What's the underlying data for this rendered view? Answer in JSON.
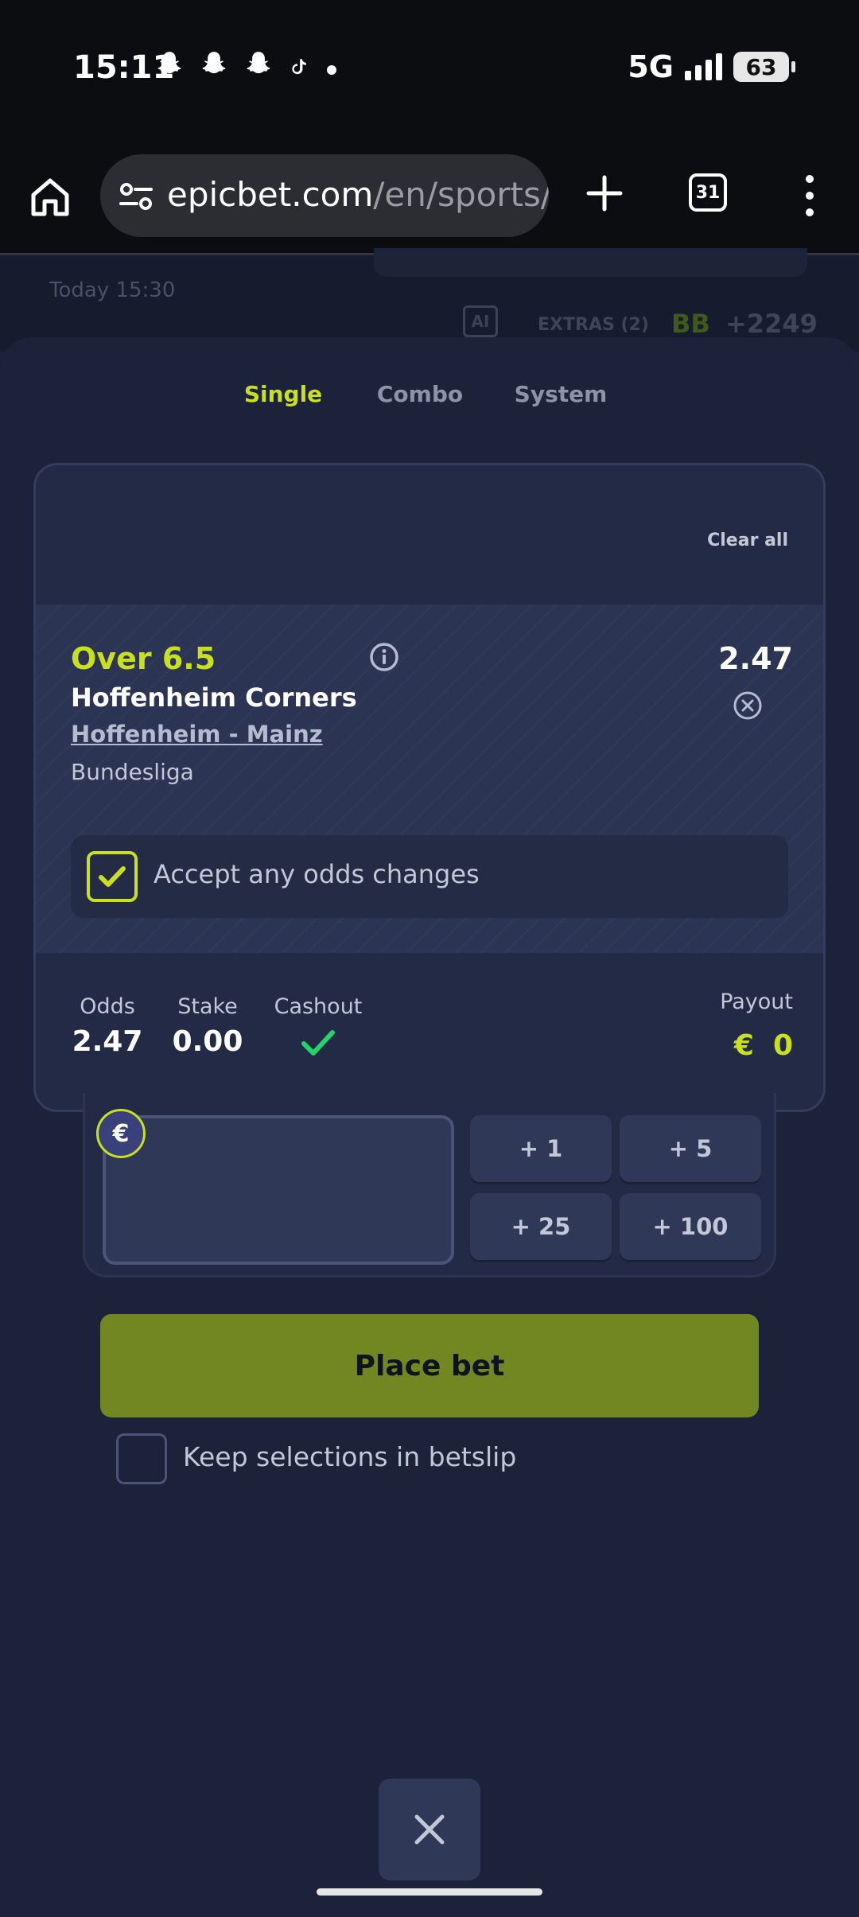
{
  "status_bar": {
    "time": "15:11",
    "notification_icons": [
      "snapchat-icon",
      "snapchat-icon",
      "snapchat-icon",
      "tiktok-icon",
      "dot-icon"
    ],
    "network": "5G",
    "battery": "63"
  },
  "browser": {
    "url_domain": "epicbet.com",
    "url_path": "/en/sports/fo",
    "tab_count": "31"
  },
  "background_page": {
    "date": "Today 15:30",
    "ai_label": "AI",
    "extras": "EXTRAS (2)",
    "bb": "BB",
    "odds": "+2249"
  },
  "betslip": {
    "tabs": [
      {
        "label": "Single",
        "active": true
      },
      {
        "label": "Combo",
        "active": false
      },
      {
        "label": "System",
        "active": false
      }
    ],
    "clear_all": "Clear all",
    "selection": {
      "pick": "Over 6.5",
      "odds": "2.47",
      "market": "Hoffenheim Corners",
      "event": "Hoffenheim - Mainz",
      "league": "Bundesliga"
    },
    "accept_odds": {
      "label": "Accept any odds changes",
      "checked": true
    },
    "summary": {
      "odds_label": "Odds",
      "odds_value": "2.47",
      "stake_label": "Stake",
      "stake_value": "0.00",
      "cashout_label": "Cashout",
      "cashout_available": true,
      "payout_label": "Payout",
      "payout_currency": "€",
      "payout_value": "0"
    },
    "stake_input": {
      "currency": "€",
      "value": ""
    },
    "quick_stakes": [
      "+ 1",
      "+ 5",
      "+ 25",
      "+ 100"
    ],
    "place_bet": "Place bet",
    "keep_selections": {
      "label": "Keep selections in betslip",
      "checked": false
    }
  },
  "colors": {
    "accent": "#c8e01e",
    "place_bet_bg": "#728622",
    "background": "#1b2239",
    "card": "#222a45"
  }
}
